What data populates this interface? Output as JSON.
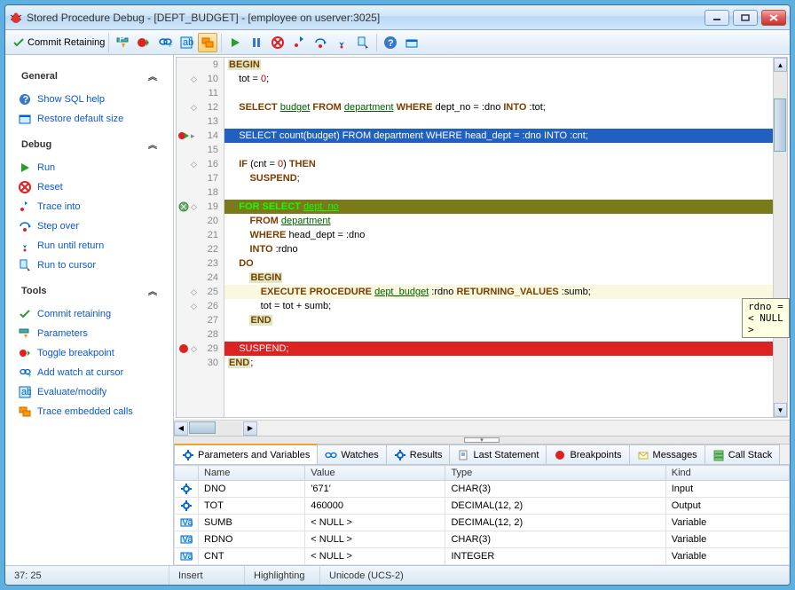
{
  "window": {
    "title": "Stored Procedure Debug - [DEPT_BUDGET] - [employee on userver:3025]"
  },
  "toolbar": {
    "commit": "Commit Retaining"
  },
  "sidebar": {
    "general": {
      "header": "General",
      "items": [
        "Show SQL help",
        "Restore default size"
      ]
    },
    "debug": {
      "header": "Debug",
      "items": [
        "Run",
        "Reset",
        "Trace into",
        "Step over",
        "Run until return",
        "Run to cursor"
      ]
    },
    "tools": {
      "header": "Tools",
      "items": [
        "Commit retaining",
        "Parameters",
        "Toggle breakpoint",
        "Add watch at cursor",
        "Evaluate/modify",
        "Trace embedded calls"
      ]
    }
  },
  "code": {
    "lines": [
      {
        "n": 9,
        "cls": "",
        "html": "<span class='kwh'>BEGIN</span>"
      },
      {
        "n": 10,
        "cls": "",
        "fold": "◇",
        "html": "    tot = <span class='num'>0</span>;"
      },
      {
        "n": 11,
        "cls": "",
        "html": ""
      },
      {
        "n": 12,
        "cls": "",
        "fold": "◇",
        "html": "    <span class='kw'>SELECT</span> <span class='ident'>budget</span> <span class='kw'>FROM</span> <span class='ident'>department</span> <span class='kw'>WHERE</span> dept_no = :dno <span class='kw'>INTO</span> :tot;"
      },
      {
        "n": 13,
        "cls": "",
        "html": ""
      },
      {
        "n": 14,
        "cls": "line-exec",
        "mark": "bp-exec",
        "fold": "▸",
        "html": "    SELECT count(budget) FROM department WHERE head_dept = :dno INTO :cnt;"
      },
      {
        "n": 15,
        "cls": "",
        "html": ""
      },
      {
        "n": 16,
        "cls": "",
        "fold": "◇",
        "html": "    <span class='kw'>IF</span> (cnt = <span class='num'>0</span>) <span class='kw'>THEN</span>"
      },
      {
        "n": 17,
        "cls": "",
        "html": "        <span class='kw'>SUSPEND</span>;"
      },
      {
        "n": 18,
        "cls": "",
        "html": ""
      },
      {
        "n": 19,
        "cls": "line-for",
        "mark": "disabled-bp",
        "fold": "◇",
        "html": "    <span class='kw'>FOR SELECT</span> <span class='gr'>dept_no</span>"
      },
      {
        "n": 20,
        "cls": "",
        "html": "        <span class='kw'>FROM</span> <span class='ident'>department</span>"
      },
      {
        "n": 21,
        "cls": "",
        "html": "        <span class='kw'>WHERE</span> head_dept = :dno"
      },
      {
        "n": 22,
        "cls": "",
        "html": "        <span class='kw'>INTO</span> :rdno"
      },
      {
        "n": 23,
        "cls": "",
        "html": "    <span class='kw'>DO</span>"
      },
      {
        "n": 24,
        "cls": "",
        "html": "        <span class='kwh'>BEGIN</span>"
      },
      {
        "n": 25,
        "cls": "line-yellow",
        "fold": "◇",
        "html": "            <span class='kw'>EXECUTE</span> <span class='kw'>PROCEDURE</span> <span class='ident'>dept_budget</span> :rdno <span class='kw'>RETURNING_VALUES</span> :sumb;"
      },
      {
        "n": 26,
        "cls": "",
        "fold": "◇",
        "html": "            tot = tot + sumb;"
      },
      {
        "n": 27,
        "cls": "",
        "html": "        <span class='kwh'>END</span>"
      },
      {
        "n": 28,
        "cls": "",
        "html": ""
      },
      {
        "n": 29,
        "cls": "line-bp",
        "mark": "bp",
        "fold": "◇",
        "html": "    SUSPEND;"
      },
      {
        "n": 30,
        "cls": "",
        "html": "<span class='kwh'>END</span>;"
      }
    ],
    "tooltip": "rdno = < NULL >"
  },
  "tabs": [
    {
      "label": "Parameters and Variables",
      "icon": "gear",
      "active": true
    },
    {
      "label": "Watches",
      "icon": "glasses"
    },
    {
      "label": "Results",
      "icon": "gear"
    },
    {
      "label": "Last Statement",
      "icon": "doc"
    },
    {
      "label": "Breakpoints",
      "icon": "bp"
    },
    {
      "label": "Messages",
      "icon": "mail"
    },
    {
      "label": "Call Stack",
      "icon": "stack"
    }
  ],
  "grid": {
    "headers": [
      "",
      "Name",
      "Value",
      "Type",
      "Kind"
    ],
    "rows": [
      {
        "icon": "gear",
        "name": "DNO",
        "value": "'671'",
        "type": "CHAR(3)",
        "kind": "Input"
      },
      {
        "icon": "gear",
        "name": "TOT",
        "value": "460000",
        "type": "DECIMAL(12, 2)",
        "kind": "Output"
      },
      {
        "icon": "var",
        "name": "SUMB",
        "value": "< NULL >",
        "type": "DECIMAL(12, 2)",
        "kind": "Variable"
      },
      {
        "icon": "var",
        "name": "RDNO",
        "value": "< NULL >",
        "type": "CHAR(3)",
        "kind": "Variable"
      },
      {
        "icon": "var",
        "name": "CNT",
        "value": "< NULL >",
        "type": "INTEGER",
        "kind": "Variable"
      }
    ]
  },
  "status": {
    "pos": "37:   25",
    "insert": "Insert",
    "highlight": "Highlighting",
    "enc": "Unicode (UCS-2)"
  }
}
